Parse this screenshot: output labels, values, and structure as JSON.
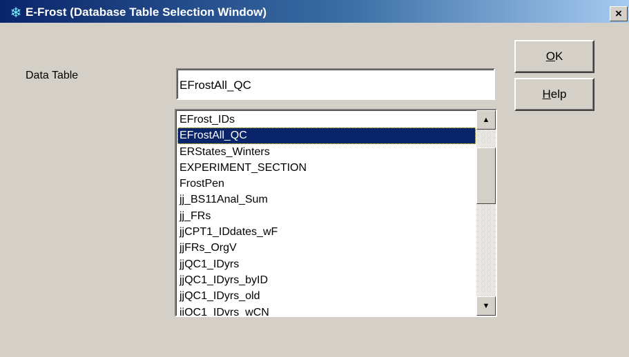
{
  "window": {
    "title": "E-Frost (Database Table Selection Window)",
    "icon": "snowflake-icon",
    "close_label": "×"
  },
  "form": {
    "data_table_label": "Data Table",
    "data_table_value": "EFrostAll_QC"
  },
  "buttons": {
    "ok_accel": "O",
    "ok_rest": "K",
    "help_accel": "H",
    "help_rest": "elp"
  },
  "list": {
    "selected_index": 1,
    "items": [
      "EFrost_IDs",
      "EFrostAll_QC",
      "ERStates_Winters",
      "EXPERIMENT_SECTION",
      "FrostPen",
      "jj_BS11Anal_Sum",
      "jj_FRs",
      "jjCPT1_IDdates_wF",
      "jjFRs_OrgV",
      "jjQC1_IDyrs",
      "jjQC1_IDyrs_byID",
      "jjQC1_IDyrs_old",
      "jjQC1_IDyrs_wCN"
    ],
    "scroll_up_glyph": "▲",
    "scroll_down_glyph": "▼"
  },
  "colors": {
    "title_bar_start": "#0a246a",
    "title_bar_end": "#a6caf0",
    "selection": "#0a246a",
    "dialog_bg": "#d4d0c8"
  }
}
